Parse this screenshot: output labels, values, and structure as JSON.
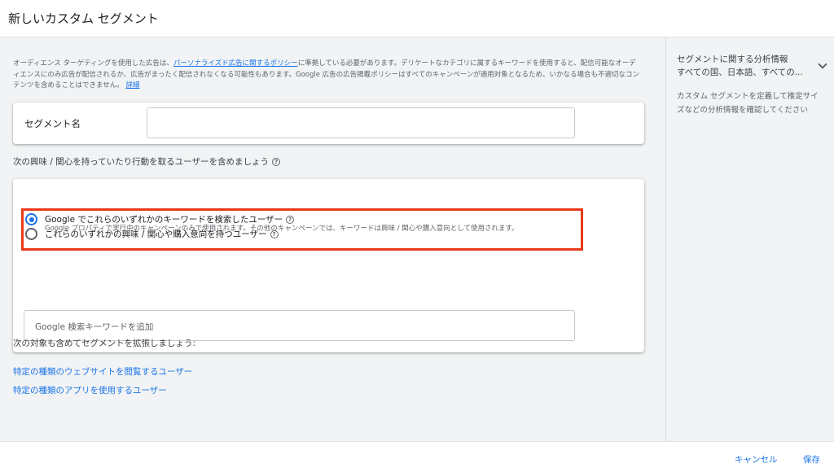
{
  "header": {
    "title": "新しいカスタム セグメント"
  },
  "policy": {
    "text_before": "オーディエンス ターゲティングを使用した広告は、",
    "link_policy": "パーソナライズド広告に関するポリシー",
    "text_after": "に準拠している必要があります。デリケートなカテゴリに属するキーワードを使用すると、配信可能なオーディエンスにのみ広告が配信されるか、広告がまったく配信されなくなる可能性もあります。Google 広告の広告掲載ポリシーはすべてのキャンペーンが適用対象となるため、いかなる場合も不適切なコンテンツを含めることはできません。",
    "link_details": "詳細"
  },
  "segment_name": {
    "label": "セグメント名",
    "value": ""
  },
  "include_question": "次の興味 / 関心を持っていたり行動を取るユーザーを含めましょう",
  "options": [
    {
      "label": "これらのいずれかの興味 / 関心や購入意向を持つユーザー",
      "checked": false
    },
    {
      "label": "Google でこれらのいずれかのキーワードを検索したユーザー",
      "description": "Google プロパティで実行中のキャンペーンのみで使用されます。その他のキャンペーンでは、キーワードは興味 / 関心や購入意向として使用されます。",
      "checked": true
    }
  ],
  "keyword_input": {
    "placeholder": "Google 検索キーワードを追加"
  },
  "expand": {
    "heading": "次の対象も含めてセグメントを拡張しましょう:",
    "links": [
      "特定の種類のウェブサイトを閲覧するユーザー",
      "特定の種類のアプリを使用するユーザー"
    ]
  },
  "side_panel": {
    "title": "セグメントに関する分析情報",
    "subtitle": "すべての国、日本語、すべての...",
    "description": "カスタム セグメントを定義して推定サイズなどの分析情報を確認してください"
  },
  "footer": {
    "cancel_label": "キャンセル",
    "save_label": "保存"
  },
  "colors": {
    "accent": "#1a73e8",
    "highlight_border": "#e8391a",
    "background": "#f1f3f4"
  }
}
